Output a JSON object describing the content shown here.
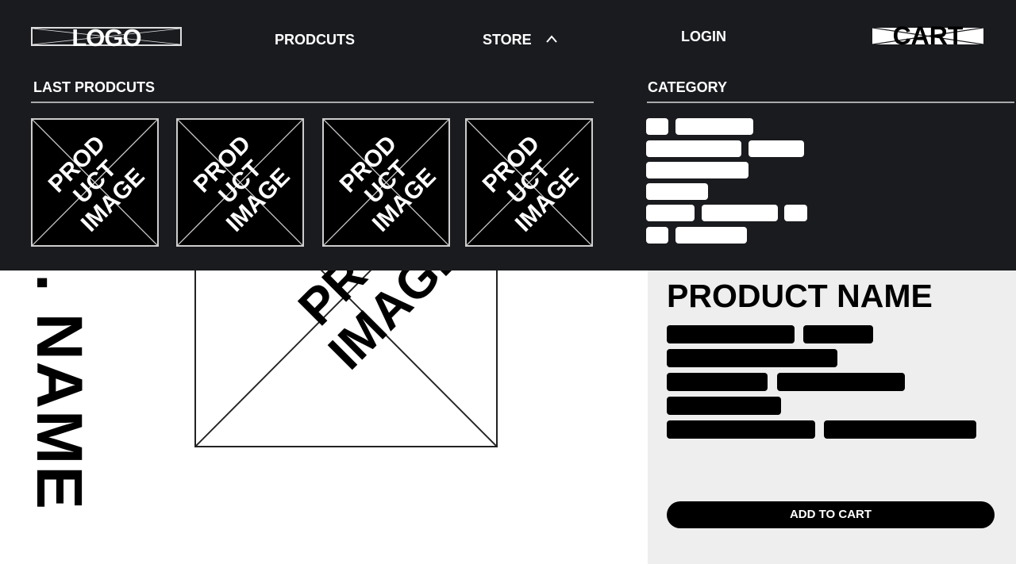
{
  "nav": {
    "logo": "LOGO",
    "products": "PRODCUTS",
    "store": "STORE",
    "login": "LOGIN",
    "cart": "CART",
    "store_icon": "chevron-up-icon"
  },
  "dropdown": {
    "last_products_heading": "LAST PRODCUTS",
    "category_heading": "CATEGORY",
    "thumbnails": [
      {
        "label": "PROD\nUCT\nIMAGE"
      },
      {
        "label": "PROD\nUCT\nIMAGE"
      },
      {
        "label": "PROD\nUCT\nIMAGE"
      },
      {
        "label": "PROD\nUCT\nIMAGE"
      }
    ]
  },
  "product": {
    "side_name": ". NAME",
    "image_label": "PROD\nIMAGE",
    "name": "PRODUCT NAME",
    "add_to_cart": "ADD TO CART"
  },
  "colors": {
    "nav_bg": "#1a1b1f",
    "panel_bg": "#eeeeee",
    "accent": "#000000"
  }
}
